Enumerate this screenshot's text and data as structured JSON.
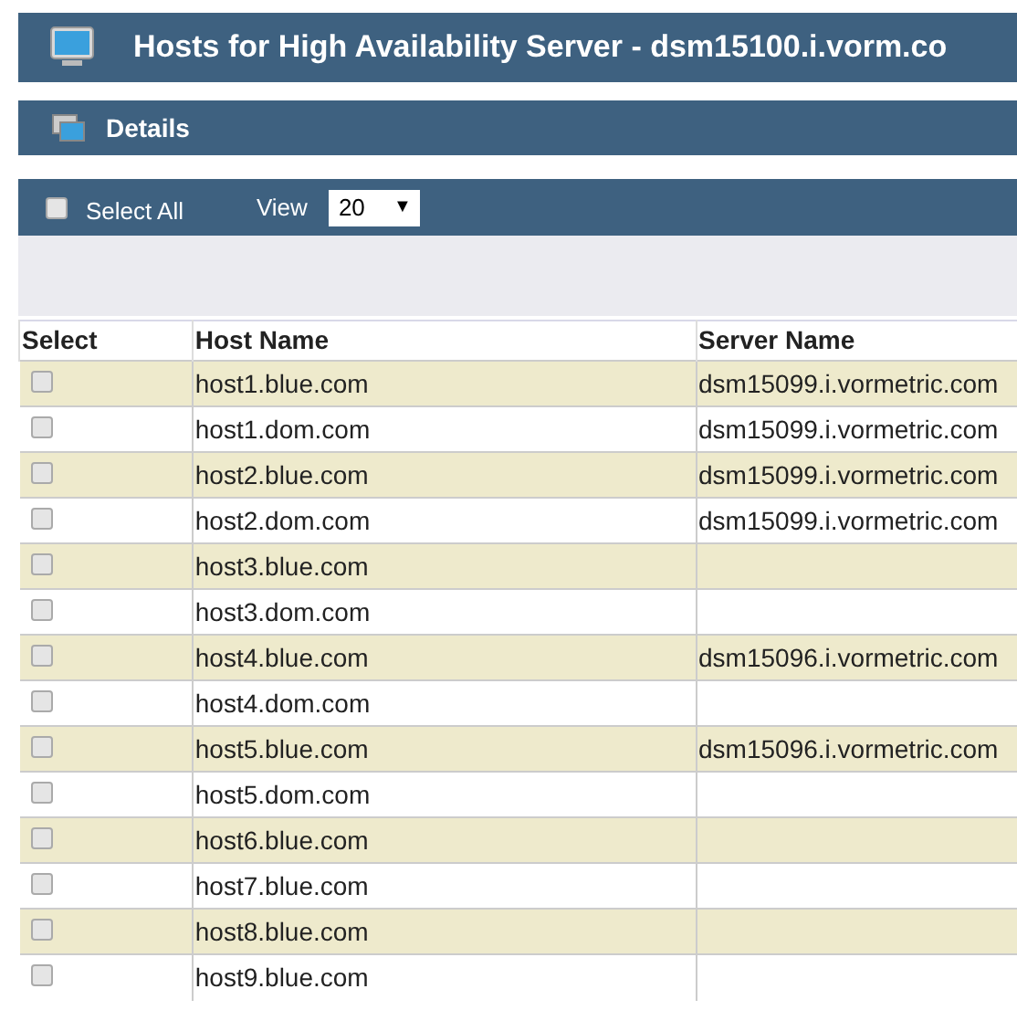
{
  "title": "Hosts for High Availability Server - dsm15100.i.vorm.co",
  "section": "Details",
  "toolbar": {
    "select_all": {
      "label": "Select All",
      "checked": false
    },
    "view_label": "View",
    "view_value": "20",
    "dropdown_arrow": "▼"
  },
  "table": {
    "columns": [
      "Select",
      "Host Name",
      "Server Name"
    ],
    "rows": [
      {
        "checked": false,
        "host": "host1.blue.com",
        "server": "dsm15099.i.vormetric.com"
      },
      {
        "checked": false,
        "host": "host1.dom.com",
        "server": "dsm15099.i.vormetric.com"
      },
      {
        "checked": false,
        "host": "host2.blue.com",
        "server": "dsm15099.i.vormetric.com"
      },
      {
        "checked": false,
        "host": "host2.dom.com",
        "server": "dsm15099.i.vormetric.com"
      },
      {
        "checked": false,
        "host": "host3.blue.com",
        "server": ""
      },
      {
        "checked": false,
        "host": "host3.dom.com",
        "server": ""
      },
      {
        "checked": false,
        "host": "host4.blue.com",
        "server": "dsm15096.i.vormetric.com"
      },
      {
        "checked": false,
        "host": "host4.dom.com",
        "server": ""
      },
      {
        "checked": false,
        "host": "host5.blue.com",
        "server": "dsm15096.i.vormetric.com"
      },
      {
        "checked": false,
        "host": "host5.dom.com",
        "server": ""
      },
      {
        "checked": false,
        "host": "host6.blue.com",
        "server": ""
      },
      {
        "checked": false,
        "host": "host7.blue.com",
        "server": ""
      },
      {
        "checked": false,
        "host": "host8.blue.com",
        "server": ""
      },
      {
        "checked": false,
        "host": "host9.blue.com",
        "server": ""
      }
    ]
  }
}
